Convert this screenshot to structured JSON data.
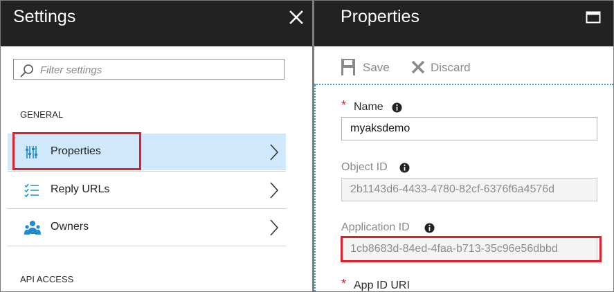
{
  "settings": {
    "title": "Settings",
    "filter_placeholder": "Filter settings",
    "sections": {
      "general": "GENERAL",
      "api_access": "API ACCESS"
    },
    "items": [
      {
        "label": "Properties",
        "icon": "properties-sliders-icon",
        "selected": true
      },
      {
        "label": "Reply URLs",
        "icon": "list-check-icon",
        "selected": false
      },
      {
        "label": "Owners",
        "icon": "owners-people-icon",
        "selected": false
      }
    ]
  },
  "properties": {
    "title": "Properties",
    "toolbar": {
      "save_label": "Save",
      "discard_label": "Discard"
    },
    "fields": {
      "name": {
        "label": "Name",
        "value": "myaksdemo"
      },
      "object_id": {
        "label": "Object ID",
        "value": "2b1143d6-4433-4780-82cf-6376f6a4576d"
      },
      "application_id": {
        "label": "Application ID",
        "value": "1cb8683d-84ed-4faa-b713-35c96e56dbbd"
      },
      "app_id_uri": {
        "label": "App ID URI"
      }
    }
  },
  "colors": {
    "header_bg": "#222222",
    "selected_bg": "#cfe8fb",
    "highlight_red": "#e0202a",
    "accent_blue": "#2aa0d8"
  }
}
